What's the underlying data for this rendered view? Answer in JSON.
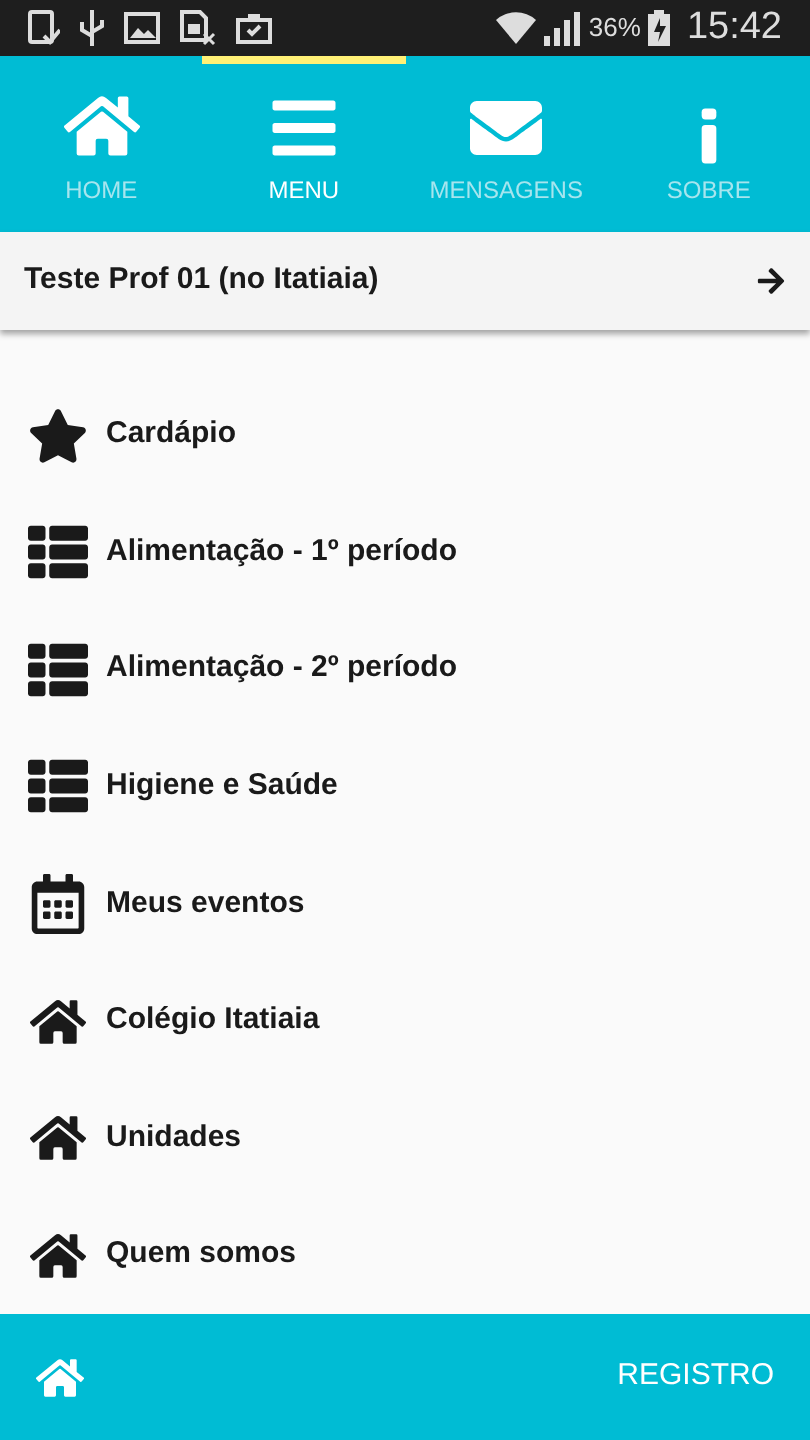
{
  "status_bar": {
    "battery": "36%",
    "time": "15:42"
  },
  "tabs": [
    {
      "label": "HOME",
      "kind": "home",
      "selected": false
    },
    {
      "label": "MENU",
      "kind": "menu",
      "selected": true
    },
    {
      "label": "MENSAGENS",
      "kind": "mail",
      "selected": false
    },
    {
      "label": "SOBRE",
      "kind": "info",
      "selected": false
    }
  ],
  "header": {
    "title": "Teste Prof 01 (no Itatiaia)"
  },
  "menu_items": [
    {
      "label": "Cardápio",
      "kind": "star"
    },
    {
      "label": "Alimentação - 1º período",
      "kind": "list"
    },
    {
      "label": "Alimentação - 2º período",
      "kind": "list"
    },
    {
      "label": "Higiene e Saúde",
      "kind": "list"
    },
    {
      "label": "Meus eventos",
      "kind": "calendar"
    },
    {
      "label": "Colégio Itatiaia",
      "kind": "home"
    },
    {
      "label": "Unidades",
      "kind": "home"
    },
    {
      "label": "Quem somos",
      "kind": "home"
    }
  ],
  "bottom_bar": {
    "button": "REGISTRO"
  }
}
